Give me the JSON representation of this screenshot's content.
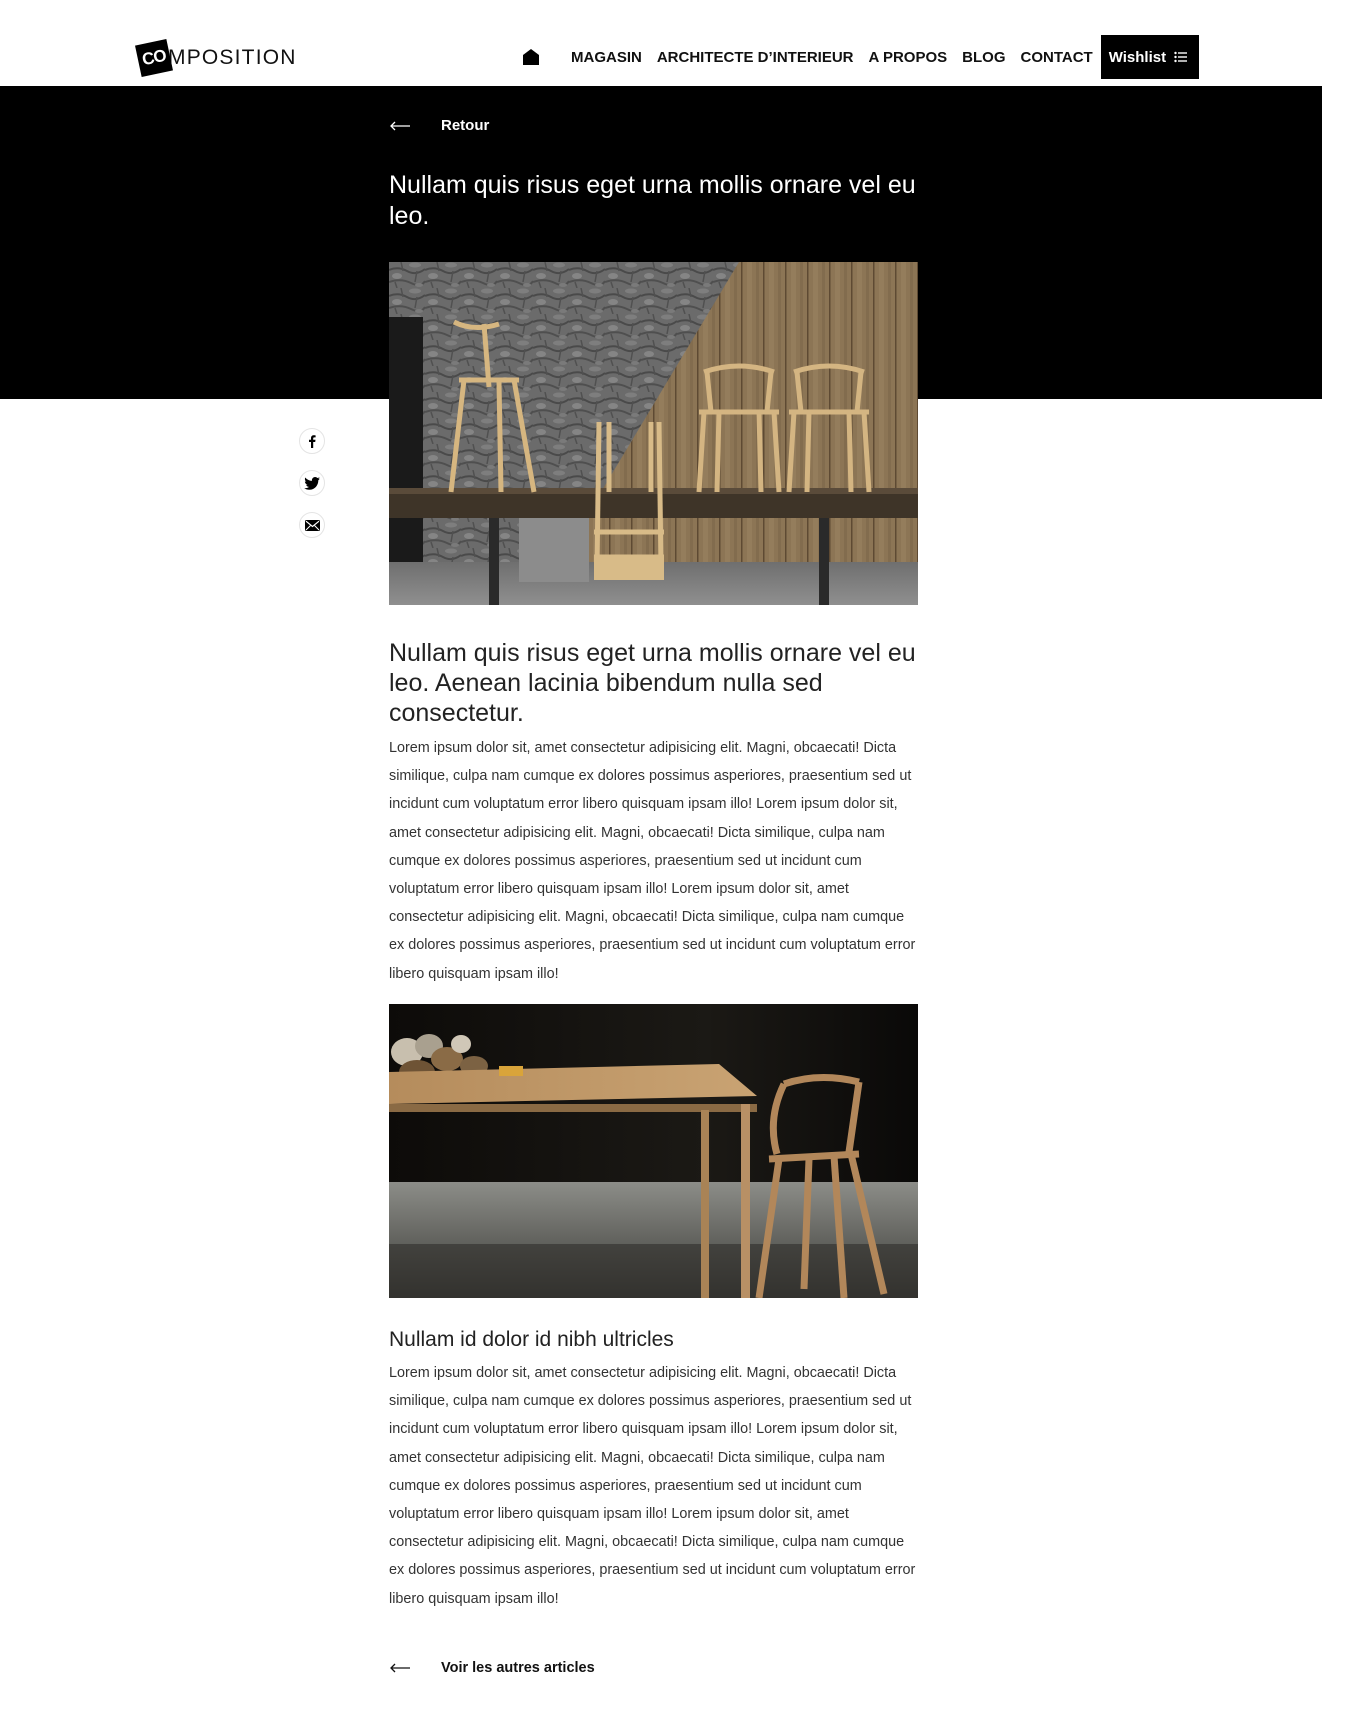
{
  "header": {
    "logo_mark": "CO",
    "logo_text": "MPOSITION",
    "nav": [
      {
        "label": "MAGASIN"
      },
      {
        "label": "ARCHITECTE D’INTERIEUR"
      },
      {
        "label": "A PROPOS"
      },
      {
        "label": "BLOG"
      },
      {
        "label": "CONTACT"
      }
    ],
    "wishlist_label": "Wishlist",
    "home_icon": "home-icon",
    "wishlist_icon": "list-icon"
  },
  "hero": {
    "back_label": "Retour",
    "title": "Nullam quis risus eget urna mollis ornare vel eu leo."
  },
  "social": {
    "icons": [
      "facebook-icon",
      "twitter-icon",
      "email-icon"
    ]
  },
  "article": {
    "section1_title": "Nullam quis risus eget urna mollis ornare vel eu leo. Aenean lacinia bibendum nulla sed consectetur.",
    "section1_body": "Lorem ipsum dolor sit, amet consectetur adipisicing elit. Magni, obcaecati! Dicta similique, culpa nam cumque ex dolores possimus asperiores, praesentium sed ut incidunt cum voluptatum error libero quisquam ipsam illo! Lorem ipsum dolor sit, amet consectetur adipisicing elit. Magni, obcaecati! Dicta similique, culpa nam cumque ex dolores possimus asperiores, praesentium sed ut incidunt cum voluptatum error libero quisquam ipsam illo! Lorem ipsum dolor sit, amet consectetur adipisicing elit. Magni, obcaecati! Dicta similique, culpa nam cumque ex dolores possimus asperiores, praesentium sed ut incidunt cum voluptatum error libero quisquam ipsam illo!",
    "section2_title": "Nullam id dolor id nibh ultricles",
    "section2_body": "Lorem ipsum dolor sit, amet consectetur adipisicing elit. Magni, obcaecati! Dicta similique, culpa nam cumque ex dolores possimus asperiores, praesentium sed ut incidunt cum voluptatum error libero quisquam ipsam illo! Lorem ipsum dolor sit, amet consectetur adipisicing elit. Magni, obcaecati! Dicta similique, culpa nam cumque ex dolores possimus asperiores, praesentium sed ut incidunt cum voluptatum error libero quisquam ipsam illo! Lorem ipsum dolor sit, amet consectetur adipisicing elit. Magni, obcaecati! Dicta similique, culpa nam cumque ex dolores possimus asperiores, praesentium sed ut incidunt cum voluptatum error libero quisquam ipsam illo!",
    "more_label": "Voir les autres articles"
  },
  "colors": {
    "hero_background": "#000000",
    "text": "#222222",
    "wishlist_background": "#000000"
  }
}
